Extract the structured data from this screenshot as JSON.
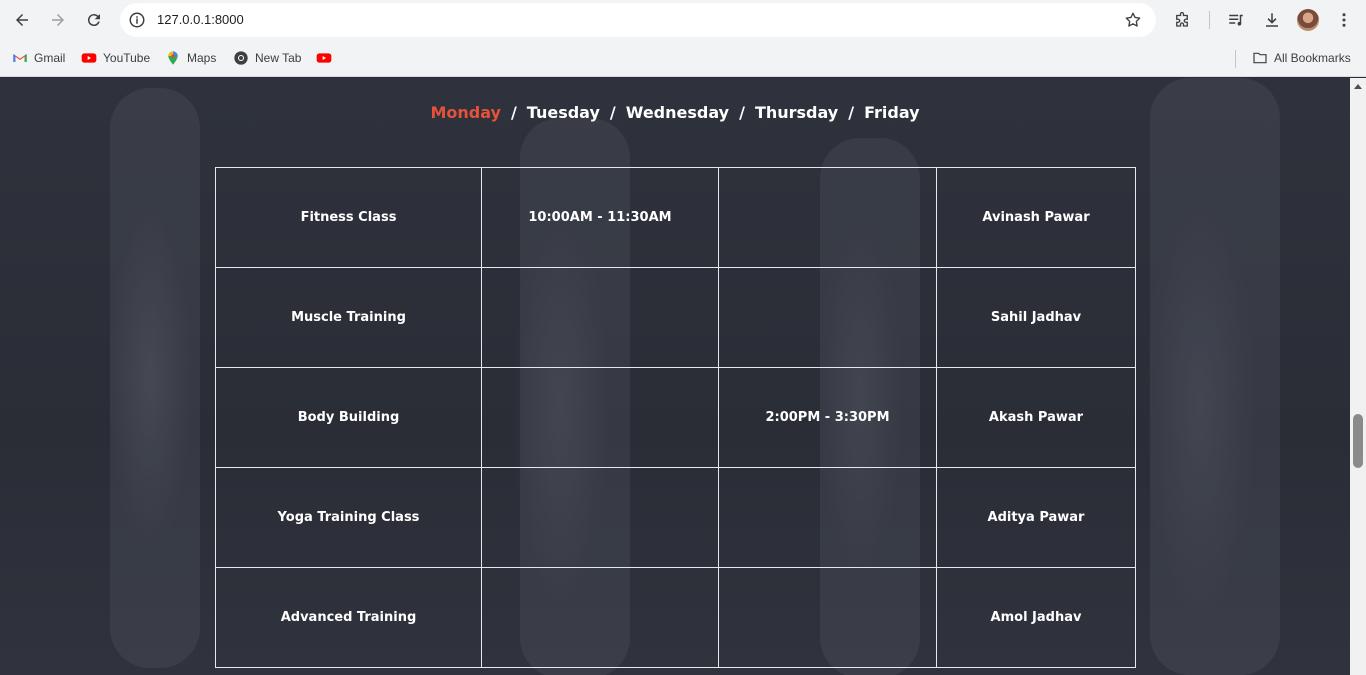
{
  "browser": {
    "url": "127.0.0.1:8000",
    "bookmarks": [
      {
        "label": "Gmail",
        "icon": "gmail-icon"
      },
      {
        "label": "YouTube",
        "icon": "youtube-icon"
      },
      {
        "label": "Maps",
        "icon": "maps-icon"
      },
      {
        "label": "New Tab",
        "icon": "chrome-icon"
      },
      {
        "label": "",
        "icon": "youtube-icon"
      }
    ],
    "all_bookmarks": "All Bookmarks"
  },
  "schedule": {
    "days": [
      {
        "label": "Monday",
        "active": true
      },
      {
        "label": "Tuesday",
        "active": false
      },
      {
        "label": "Wednesday",
        "active": false
      },
      {
        "label": "Thursday",
        "active": false
      },
      {
        "label": "Friday",
        "active": false
      }
    ],
    "separator": "/",
    "rows": [
      {
        "class": "Fitness Class",
        "time_a": "10:00AM - 11:30AM",
        "time_b": "",
        "trainer": "Avinash Pawar"
      },
      {
        "class": "Muscle Training",
        "time_a": "",
        "time_b": "",
        "trainer": "Sahil Jadhav"
      },
      {
        "class": "Body Building",
        "time_a": "",
        "time_b": "2:00PM - 3:30PM",
        "trainer": "Akash Pawar"
      },
      {
        "class": "Yoga Training Class",
        "time_a": "",
        "time_b": "",
        "trainer": "Aditya Pawar"
      },
      {
        "class": "Advanced Training",
        "time_a": "",
        "time_b": "",
        "trainer": "Amol Jadhav"
      }
    ]
  },
  "colors": {
    "active_day": "#e5513a",
    "text": "#ffffff",
    "overlay": "#2b2e37"
  }
}
